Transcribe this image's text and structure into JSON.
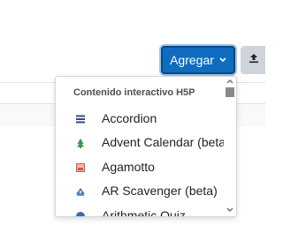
{
  "toolbar": {
    "add_label": "Agregar",
    "add_caret_icon": "chevron-down-icon",
    "upload_icon": "upload-icon",
    "accent_color": "#0f6cbf"
  },
  "dropdown": {
    "header": "Contenido interactivo H5P",
    "items": [
      {
        "label": "Accordion",
        "icon": "accordion-icon"
      },
      {
        "label": "Advent Calendar (beta)",
        "icon": "tree-icon"
      },
      {
        "label": "Agamotto",
        "icon": "agamotto-icon"
      },
      {
        "label": "AR Scavenger (beta)",
        "icon": "ar-scavenger-icon"
      },
      {
        "label": "Arithmetic Quiz",
        "icon": "quiz-icon"
      }
    ]
  }
}
